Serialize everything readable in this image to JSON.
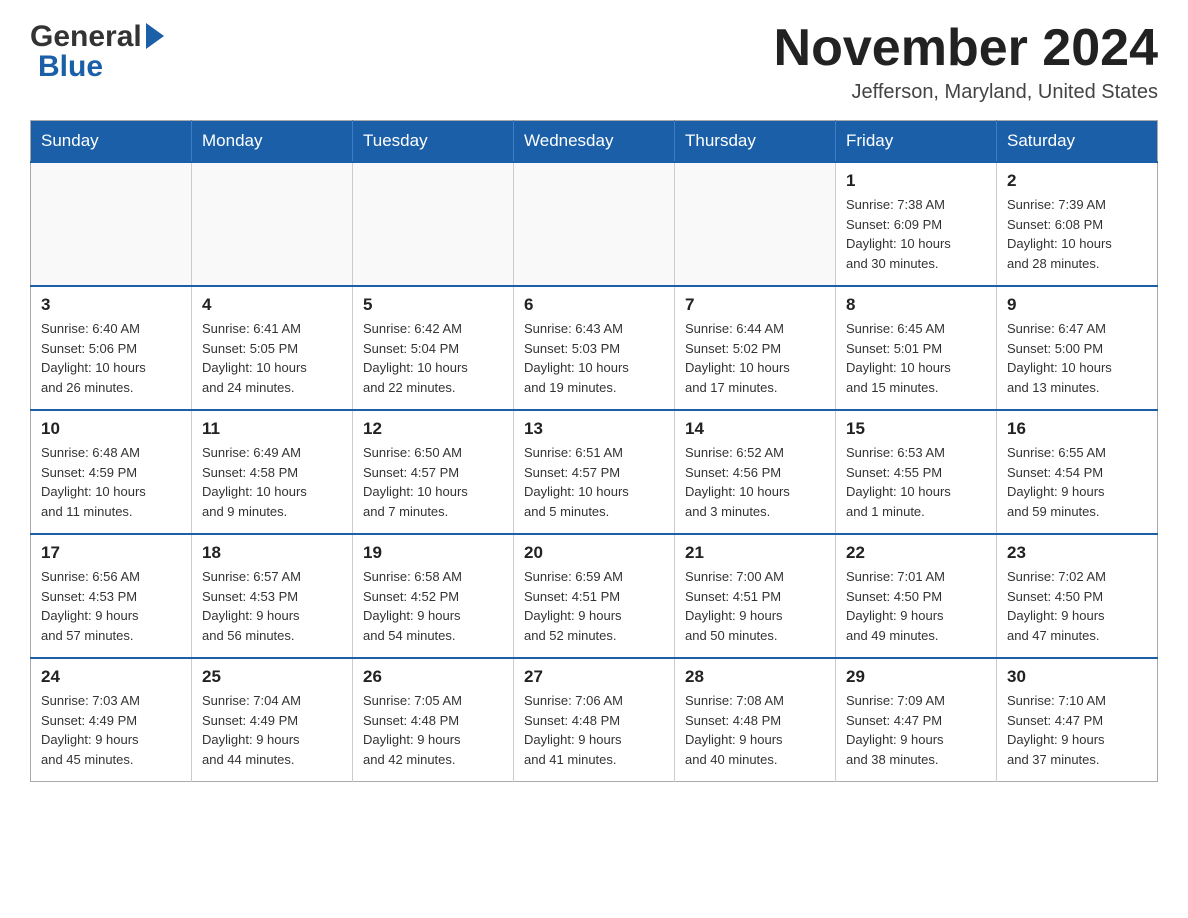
{
  "header": {
    "title": "November 2024",
    "subtitle": "Jefferson, Maryland, United States",
    "logo_general": "General",
    "logo_blue": "Blue"
  },
  "days_of_week": [
    "Sunday",
    "Monday",
    "Tuesday",
    "Wednesday",
    "Thursday",
    "Friday",
    "Saturday"
  ],
  "weeks": [
    [
      {
        "day": "",
        "info": ""
      },
      {
        "day": "",
        "info": ""
      },
      {
        "day": "",
        "info": ""
      },
      {
        "day": "",
        "info": ""
      },
      {
        "day": "",
        "info": ""
      },
      {
        "day": "1",
        "info": "Sunrise: 7:38 AM\nSunset: 6:09 PM\nDaylight: 10 hours\nand 30 minutes."
      },
      {
        "day": "2",
        "info": "Sunrise: 7:39 AM\nSunset: 6:08 PM\nDaylight: 10 hours\nand 28 minutes."
      }
    ],
    [
      {
        "day": "3",
        "info": "Sunrise: 6:40 AM\nSunset: 5:06 PM\nDaylight: 10 hours\nand 26 minutes."
      },
      {
        "day": "4",
        "info": "Sunrise: 6:41 AM\nSunset: 5:05 PM\nDaylight: 10 hours\nand 24 minutes."
      },
      {
        "day": "5",
        "info": "Sunrise: 6:42 AM\nSunset: 5:04 PM\nDaylight: 10 hours\nand 22 minutes."
      },
      {
        "day": "6",
        "info": "Sunrise: 6:43 AM\nSunset: 5:03 PM\nDaylight: 10 hours\nand 19 minutes."
      },
      {
        "day": "7",
        "info": "Sunrise: 6:44 AM\nSunset: 5:02 PM\nDaylight: 10 hours\nand 17 minutes."
      },
      {
        "day": "8",
        "info": "Sunrise: 6:45 AM\nSunset: 5:01 PM\nDaylight: 10 hours\nand 15 minutes."
      },
      {
        "day": "9",
        "info": "Sunrise: 6:47 AM\nSunset: 5:00 PM\nDaylight: 10 hours\nand 13 minutes."
      }
    ],
    [
      {
        "day": "10",
        "info": "Sunrise: 6:48 AM\nSunset: 4:59 PM\nDaylight: 10 hours\nand 11 minutes."
      },
      {
        "day": "11",
        "info": "Sunrise: 6:49 AM\nSunset: 4:58 PM\nDaylight: 10 hours\nand 9 minutes."
      },
      {
        "day": "12",
        "info": "Sunrise: 6:50 AM\nSunset: 4:57 PM\nDaylight: 10 hours\nand 7 minutes."
      },
      {
        "day": "13",
        "info": "Sunrise: 6:51 AM\nSunset: 4:57 PM\nDaylight: 10 hours\nand 5 minutes."
      },
      {
        "day": "14",
        "info": "Sunrise: 6:52 AM\nSunset: 4:56 PM\nDaylight: 10 hours\nand 3 minutes."
      },
      {
        "day": "15",
        "info": "Sunrise: 6:53 AM\nSunset: 4:55 PM\nDaylight: 10 hours\nand 1 minute."
      },
      {
        "day": "16",
        "info": "Sunrise: 6:55 AM\nSunset: 4:54 PM\nDaylight: 9 hours\nand 59 minutes."
      }
    ],
    [
      {
        "day": "17",
        "info": "Sunrise: 6:56 AM\nSunset: 4:53 PM\nDaylight: 9 hours\nand 57 minutes."
      },
      {
        "day": "18",
        "info": "Sunrise: 6:57 AM\nSunset: 4:53 PM\nDaylight: 9 hours\nand 56 minutes."
      },
      {
        "day": "19",
        "info": "Sunrise: 6:58 AM\nSunset: 4:52 PM\nDaylight: 9 hours\nand 54 minutes."
      },
      {
        "day": "20",
        "info": "Sunrise: 6:59 AM\nSunset: 4:51 PM\nDaylight: 9 hours\nand 52 minutes."
      },
      {
        "day": "21",
        "info": "Sunrise: 7:00 AM\nSunset: 4:51 PM\nDaylight: 9 hours\nand 50 minutes."
      },
      {
        "day": "22",
        "info": "Sunrise: 7:01 AM\nSunset: 4:50 PM\nDaylight: 9 hours\nand 49 minutes."
      },
      {
        "day": "23",
        "info": "Sunrise: 7:02 AM\nSunset: 4:50 PM\nDaylight: 9 hours\nand 47 minutes."
      }
    ],
    [
      {
        "day": "24",
        "info": "Sunrise: 7:03 AM\nSunset: 4:49 PM\nDaylight: 9 hours\nand 45 minutes."
      },
      {
        "day": "25",
        "info": "Sunrise: 7:04 AM\nSunset: 4:49 PM\nDaylight: 9 hours\nand 44 minutes."
      },
      {
        "day": "26",
        "info": "Sunrise: 7:05 AM\nSunset: 4:48 PM\nDaylight: 9 hours\nand 42 minutes."
      },
      {
        "day": "27",
        "info": "Sunrise: 7:06 AM\nSunset: 4:48 PM\nDaylight: 9 hours\nand 41 minutes."
      },
      {
        "day": "28",
        "info": "Sunrise: 7:08 AM\nSunset: 4:48 PM\nDaylight: 9 hours\nand 40 minutes."
      },
      {
        "day": "29",
        "info": "Sunrise: 7:09 AM\nSunset: 4:47 PM\nDaylight: 9 hours\nand 38 minutes."
      },
      {
        "day": "30",
        "info": "Sunrise: 7:10 AM\nSunset: 4:47 PM\nDaylight: 9 hours\nand 37 minutes."
      }
    ]
  ]
}
